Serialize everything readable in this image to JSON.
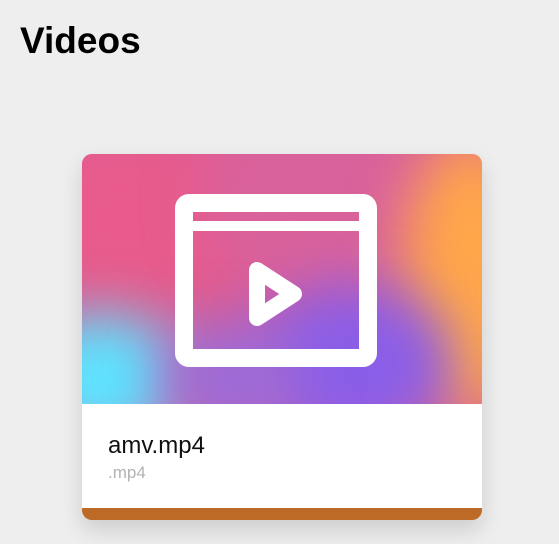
{
  "page": {
    "title": "Videos"
  },
  "videos": [
    {
      "name": "amv.mp4",
      "extension": ".mp4",
      "thumbnail_icon": "video-player-icon",
      "accent_color": "#bd6a27"
    }
  ],
  "colors": {
    "background": "#eeeeee",
    "card": "#ffffff",
    "gradient_pink": "#e85b8c",
    "gradient_magenta": "#d8609a",
    "gradient_orange": "#ffa64a",
    "gradient_cyan": "#5ee3ff",
    "gradient_purple": "#8a5ee8"
  }
}
